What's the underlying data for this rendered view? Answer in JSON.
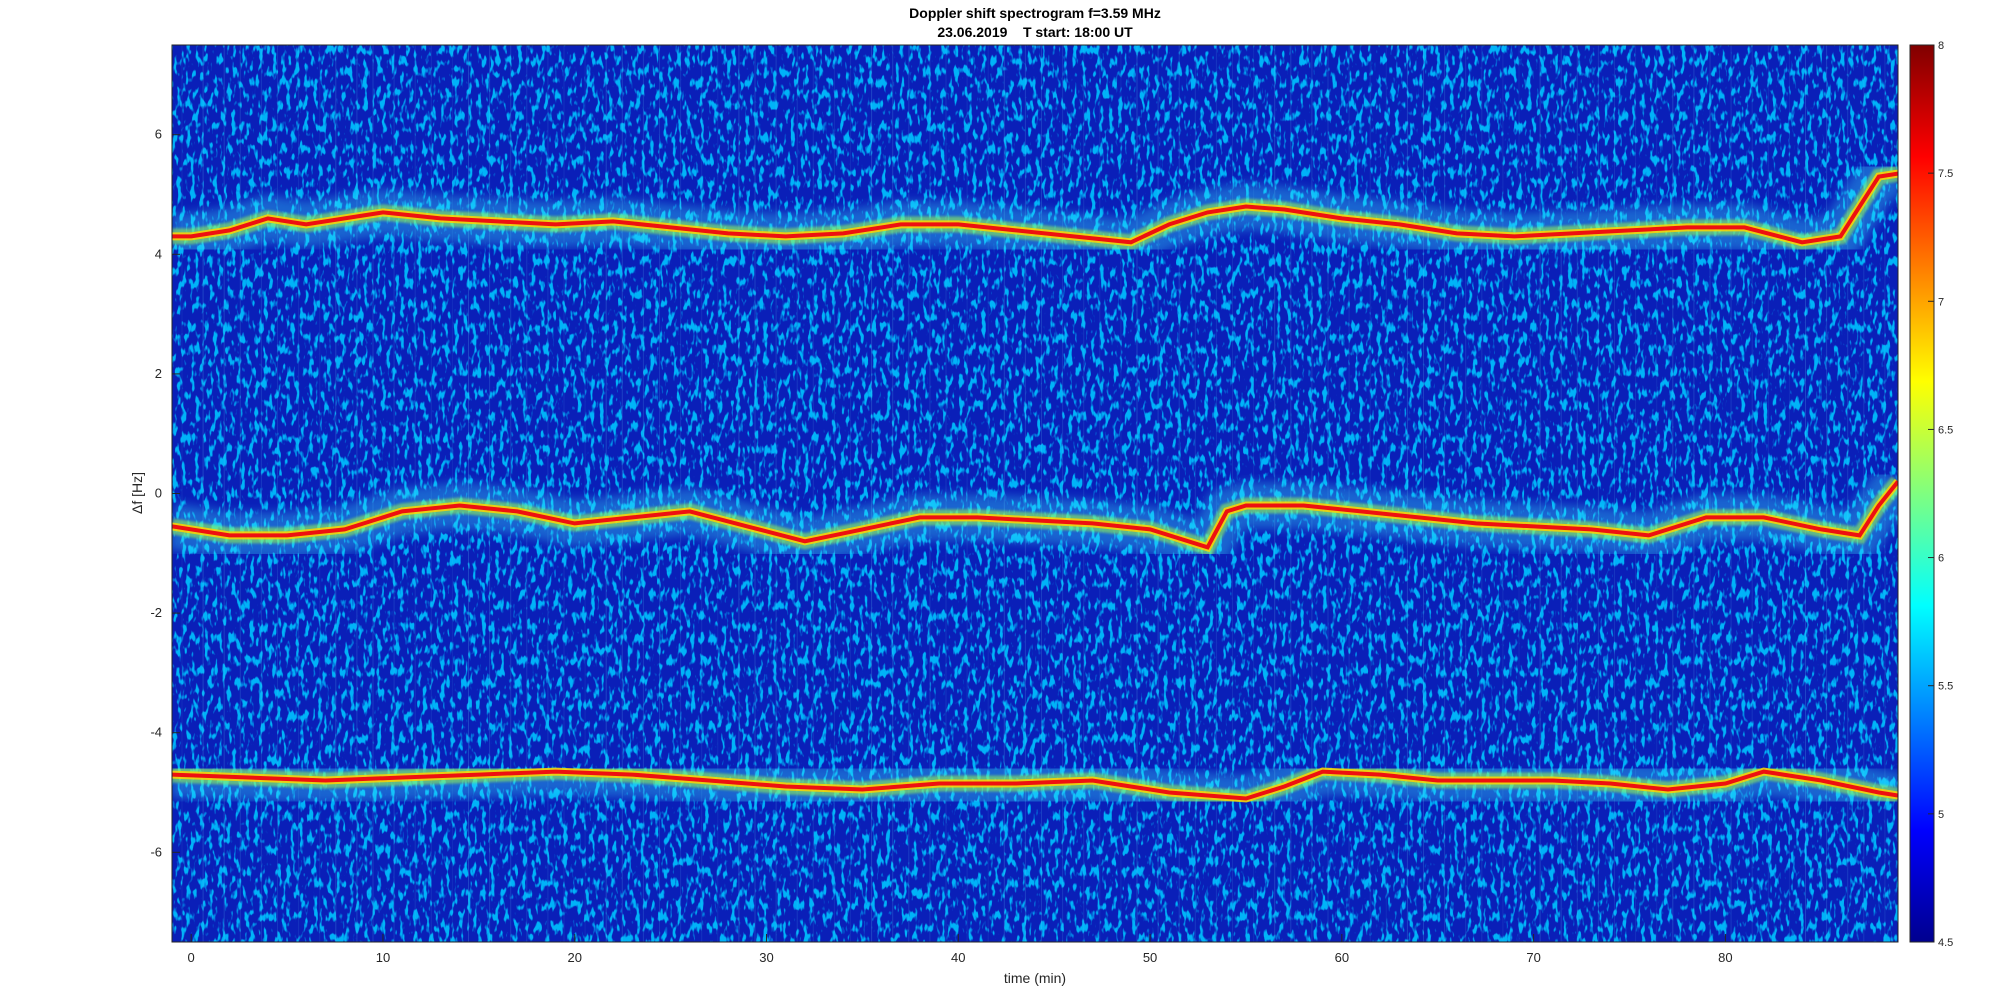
{
  "chart_data": {
    "type": "heatmap",
    "title": "Doppler shift spectrogram f=3.59 MHz",
    "subtitle": "23.06.2019    T start: 18:00 UT",
    "xlabel": "time (min)",
    "ylabel": "Δf [Hz]",
    "xlim": [
      -1,
      89
    ],
    "ylim": [
      -7.5,
      7.5
    ],
    "x_ticks": [
      0,
      10,
      20,
      30,
      40,
      50,
      60,
      70,
      80
    ],
    "y_ticks": [
      -6,
      -4,
      -2,
      0,
      2,
      4,
      6
    ],
    "colorbar": {
      "min": 4.5,
      "max": 8,
      "ticks": [
        4.5,
        5,
        5.5,
        6,
        6.5,
        7,
        7.5,
        8
      ],
      "colormap": "jet"
    },
    "series": [
      {
        "x": [
          -1,
          0,
          2,
          4,
          6,
          8,
          10,
          13,
          16,
          19,
          22,
          25,
          28,
          31,
          34,
          37,
          40,
          43,
          46,
          49,
          51,
          53,
          55,
          57,
          60,
          63,
          66,
          69,
          72,
          75,
          78,
          81,
          84,
          86,
          87,
          88,
          89
        ],
        "y": [
          4.3,
          4.3,
          4.4,
          4.6,
          4.5,
          4.6,
          4.7,
          4.6,
          4.55,
          4.5,
          4.55,
          4.45,
          4.35,
          4.3,
          4.35,
          4.5,
          4.5,
          4.4,
          4.3,
          4.2,
          4.5,
          4.7,
          4.8,
          4.75,
          4.6,
          4.5,
          4.35,
          4.3,
          4.35,
          4.4,
          4.45,
          4.45,
          4.2,
          4.3,
          4.8,
          5.3,
          5.35
        ]
      },
      {
        "x": [
          -1,
          2,
          5,
          8,
          9,
          11,
          14,
          17,
          20,
          23,
          26,
          29,
          32,
          35,
          38,
          41,
          44,
          47,
          50,
          53,
          54,
          55,
          56,
          58,
          61,
          64,
          67,
          70,
          73,
          76,
          79,
          82,
          85,
          87,
          88,
          89
        ],
        "y": [
          -0.55,
          -0.7,
          -0.7,
          -0.6,
          -0.5,
          -0.3,
          -0.2,
          -0.3,
          -0.5,
          -0.4,
          -0.3,
          -0.55,
          -0.8,
          -0.6,
          -0.4,
          -0.4,
          -0.45,
          -0.5,
          -0.6,
          -0.9,
          -0.3,
          -0.2,
          -0.2,
          -0.2,
          -0.3,
          -0.4,
          -0.5,
          -0.55,
          -0.6,
          -0.7,
          -0.4,
          -0.4,
          -0.6,
          -0.7,
          -0.2,
          0.2
        ]
      },
      {
        "x": [
          -1,
          3,
          7,
          11,
          15,
          19,
          23,
          27,
          31,
          35,
          39,
          43,
          47,
          51,
          55,
          57,
          59,
          62,
          65,
          68,
          71,
          74,
          77,
          80,
          82,
          85,
          88,
          89
        ],
        "y": [
          -4.7,
          -4.75,
          -4.8,
          -4.75,
          -4.7,
          -4.65,
          -4.7,
          -4.8,
          -4.9,
          -4.95,
          -4.85,
          -4.85,
          -4.8,
          -5.0,
          -5.1,
          -4.9,
          -4.65,
          -4.7,
          -4.8,
          -4.8,
          -4.8,
          -4.85,
          -4.95,
          -4.85,
          -4.65,
          -4.8,
          -5.0,
          -5.05
        ]
      }
    ],
    "grid": false,
    "legend": "none"
  }
}
